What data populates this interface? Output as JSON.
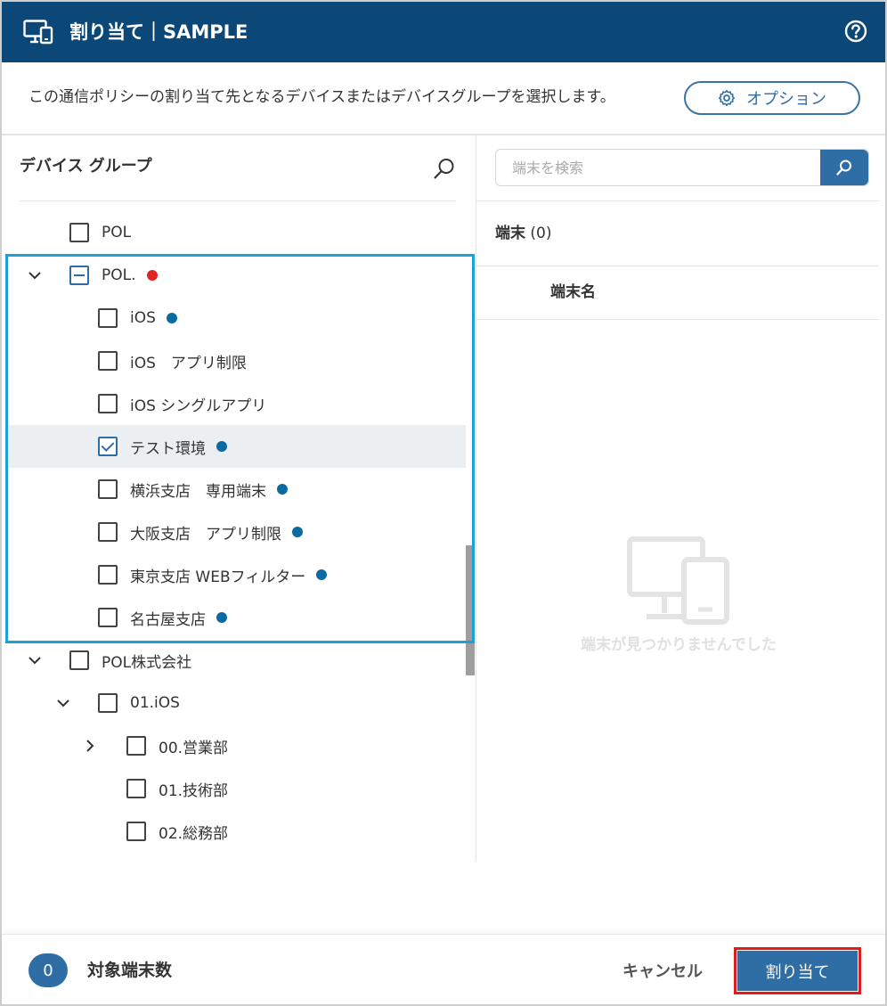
{
  "colors": {
    "header_bg": "#0b4878",
    "accent": "#2f6ea5",
    "dot_blue": "#0b6aa0",
    "dot_red": "#e02424",
    "highlight": "#1ea0d6",
    "assign_highlight": "#e31a1a"
  },
  "header": {
    "title": "割り当て｜SAMPLE",
    "icon": "devices-icon",
    "help_icon": "help-icon"
  },
  "description": "この通信ポリシーの割り当て先となるデバイスまたはデバイスグループを選択します。",
  "options_button": {
    "label": "オプション",
    "icon": "gear-icon"
  },
  "left_panel": {
    "title": "デバイス グループ",
    "search_icon": "search-icon",
    "tree": [
      {
        "label": "POL",
        "checked": false,
        "state": "unchecked",
        "dot": null,
        "chevron": null
      },
      {
        "label": "POL.",
        "checked": false,
        "state": "partial",
        "dot": "red",
        "chevron": "down"
      },
      {
        "label": "iOS",
        "checked": false,
        "state": "unchecked",
        "dot": "blue",
        "chevron": null
      },
      {
        "label": "iOS　アプリ制限",
        "checked": false,
        "state": "unchecked",
        "dot": null,
        "chevron": null
      },
      {
        "label": "iOS シングルアプリ",
        "checked": false,
        "state": "unchecked",
        "dot": null,
        "chevron": null
      },
      {
        "label": "テスト環境",
        "checked": true,
        "state": "checked",
        "dot": "blue",
        "chevron": null,
        "selected": true
      },
      {
        "label": "横浜支店　専用端末",
        "checked": false,
        "state": "unchecked",
        "dot": "blue",
        "chevron": null
      },
      {
        "label": "大阪支店　アプリ制限",
        "checked": false,
        "state": "unchecked",
        "dot": "blue",
        "chevron": null
      },
      {
        "label": "東京支店 WEBフィルター",
        "checked": false,
        "state": "unchecked",
        "dot": "blue",
        "chevron": null
      },
      {
        "label": "名古屋支店",
        "checked": false,
        "state": "unchecked",
        "dot": "blue",
        "chevron": null
      },
      {
        "label": "POL株式会社",
        "checked": false,
        "state": "unchecked",
        "dot": null,
        "chevron": "down"
      },
      {
        "label": "01.iOS",
        "checked": false,
        "state": "unchecked",
        "dot": null,
        "chevron": "down"
      },
      {
        "label": "00.営業部",
        "checked": false,
        "state": "unchecked",
        "dot": null,
        "chevron": "right"
      },
      {
        "label": "01.技術部",
        "checked": false,
        "state": "unchecked",
        "dot": null,
        "chevron": null
      },
      {
        "label": "02.総務部",
        "checked": false,
        "state": "unchecked",
        "dot": null,
        "chevron": null
      }
    ]
  },
  "right_panel": {
    "search_placeholder": "端末を検索",
    "device_count_label": "端末",
    "device_count": "(0)",
    "column_header": "端末名",
    "empty_icon": "devices-empty-icon",
    "empty_message": "端末が見つかりませんでした"
  },
  "footer": {
    "count_value": "0",
    "count_label": "対象端末数",
    "cancel_label": "キャンセル",
    "assign_label": "割り当て"
  }
}
